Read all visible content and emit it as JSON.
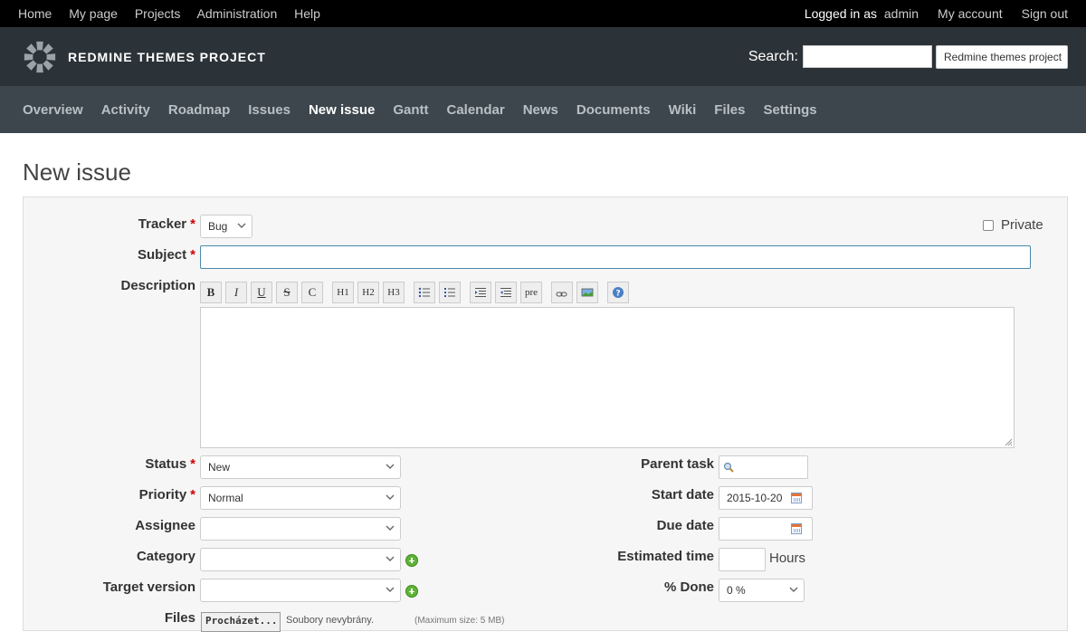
{
  "topbar": {
    "left": [
      "Home",
      "My page",
      "Projects",
      "Administration",
      "Help"
    ],
    "logged_prefix": "Logged in as",
    "user": "admin",
    "my_account": "My account",
    "sign_out": "Sign out"
  },
  "header": {
    "title": "REDMINE THEMES PROJECT",
    "search_label": "Search:",
    "search_value": "",
    "project_select": "Redmine themes project"
  },
  "nav": {
    "items": [
      "Overview",
      "Activity",
      "Roadmap",
      "Issues",
      "New issue",
      "Gantt",
      "Calendar",
      "News",
      "Documents",
      "Wiki",
      "Files",
      "Settings"
    ],
    "active": "New issue"
  },
  "page": {
    "title": "New issue"
  },
  "form": {
    "tracker_label": "Tracker",
    "tracker_value": "Bug",
    "private_label": "Private",
    "subject_label": "Subject",
    "subject_value": "",
    "description_label": "Description",
    "toolbar": [
      "B",
      "I",
      "U",
      "S",
      "C",
      "H1",
      "H2",
      "H3",
      "ul",
      "ol",
      "indent",
      "outdent",
      "pre",
      "link",
      "image",
      "help"
    ],
    "toolbar_pre": "pre",
    "status_label": "Status",
    "status_value": "New",
    "priority_label": "Priority",
    "priority_value": "Normal",
    "assignee_label": "Assignee",
    "assignee_value": "",
    "category_label": "Category",
    "category_value": "",
    "target_version_label": "Target version",
    "target_version_value": "",
    "files_label": "Files",
    "files_button": "Procházet...",
    "files_status": "Soubory nevybrány.",
    "files_max": "(Maximum size: 5 MB)",
    "parent_task_label": "Parent task",
    "start_date_label": "Start date",
    "start_date_value": "2015-10-20",
    "due_date_label": "Due date",
    "due_date_value": "",
    "estimated_time_label": "Estimated time",
    "estimated_time_unit": "Hours",
    "done_label": "% Done",
    "done_value": "0 %"
  },
  "colors": {
    "topbar_bg": "#000000",
    "header_bg": "#2c3338",
    "nav_bg": "#3d464d",
    "required": "#cc0000"
  }
}
